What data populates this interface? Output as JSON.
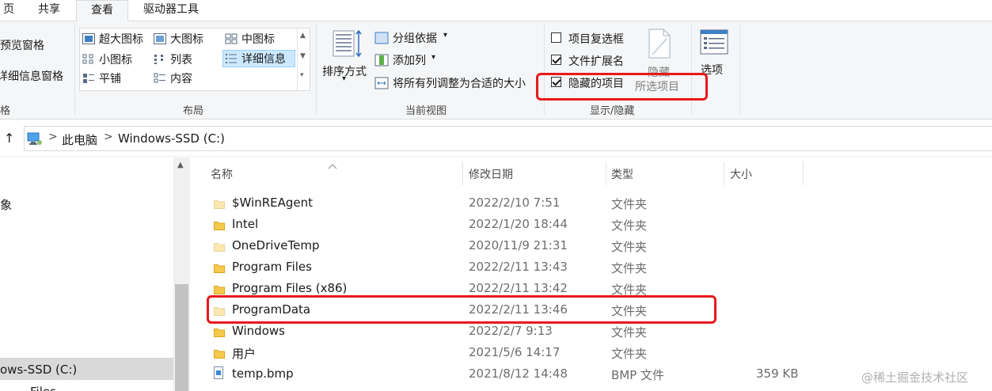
{
  "tabs": [
    {
      "label": "页",
      "active": false
    },
    {
      "label": "共享",
      "active": false
    },
    {
      "label": "查看",
      "active": true
    },
    {
      "label": "驱动器工具",
      "active": false
    }
  ],
  "ribbon": {
    "pane": {
      "preview_pane": "预览窗格",
      "details_pane": "详细信息窗格",
      "group_label": "格"
    },
    "layout": {
      "items": [
        {
          "label": "超大图标",
          "selected": false
        },
        {
          "label": "大图标",
          "selected": false
        },
        {
          "label": "中图标",
          "selected": false
        },
        {
          "label": "小图标",
          "selected": false
        },
        {
          "label": "列表",
          "selected": false
        },
        {
          "label": "详细信息",
          "selected": true
        },
        {
          "label": "平铺",
          "selected": false
        },
        {
          "label": "内容",
          "selected": false
        }
      ],
      "group_label": "布局"
    },
    "current_view": {
      "sort_by": "排序方式",
      "group_by": "分组依据",
      "add_column": "添加列",
      "size_all_columns": "将所有列调整为合适的大小",
      "group_label": "当前视图"
    },
    "show_hide": {
      "item_checkboxes": {
        "label": "项目复选框",
        "checked": false
      },
      "file_extensions": {
        "label": "文件扩展名",
        "checked": true
      },
      "hidden_items": {
        "label": "隐藏的项目",
        "checked": true
      },
      "hide_selected_label": "隐藏",
      "hide_selected_sub": "所选项目",
      "group_label": "显示/隐藏"
    },
    "options": {
      "label": "选项"
    }
  },
  "address": {
    "up_arrow": "↑",
    "breadcrumbs": [
      "此电脑",
      "Windows-SSD (C:)"
    ],
    "separator": ">"
  },
  "nav": {
    "items": [
      {
        "label": "象"
      },
      {
        "label": "ows-SSD (C:)"
      },
      {
        "label": "Files"
      }
    ]
  },
  "file_list": {
    "columns": [
      "名称",
      "修改日期",
      "类型",
      "大小"
    ],
    "rows": [
      {
        "name": "$WinREAgent",
        "modified": "2022/2/10 7:51",
        "type": "文件夹",
        "size": "",
        "kind": "folder",
        "dim": true
      },
      {
        "name": "Intel",
        "modified": "2022/1/20 18:44",
        "type": "文件夹",
        "size": "",
        "kind": "folder",
        "dim": false
      },
      {
        "name": "OneDriveTemp",
        "modified": "2020/11/9 21:31",
        "type": "文件夹",
        "size": "",
        "kind": "folder",
        "dim": true
      },
      {
        "name": "Program Files",
        "modified": "2022/2/11 13:43",
        "type": "文件夹",
        "size": "",
        "kind": "folder",
        "dim": false
      },
      {
        "name": "Program Files (x86)",
        "modified": "2022/2/11 13:42",
        "type": "文件夹",
        "size": "",
        "kind": "folder",
        "dim": false
      },
      {
        "name": "ProgramData",
        "modified": "2022/2/11 13:46",
        "type": "文件夹",
        "size": "",
        "kind": "folder",
        "dim": true
      },
      {
        "name": "Windows",
        "modified": "2022/2/7 9:13",
        "type": "文件夹",
        "size": "",
        "kind": "folder",
        "dim": false
      },
      {
        "name": "用户",
        "modified": "2021/5/6 14:17",
        "type": "文件夹",
        "size": "",
        "kind": "folder",
        "dim": false
      },
      {
        "name": "temp.bmp",
        "modified": "2021/8/12 14:48",
        "type": "BMP 文件",
        "size": "359 KB",
        "kind": "file",
        "dim": false
      }
    ]
  },
  "watermark": "@稀土掘金技术社区",
  "colors": {
    "folder": "#f6c94c",
    "folder_dim": "#fbe7b0",
    "highlight_red": "#e8191d",
    "selection_blue": "#cce8ff"
  }
}
